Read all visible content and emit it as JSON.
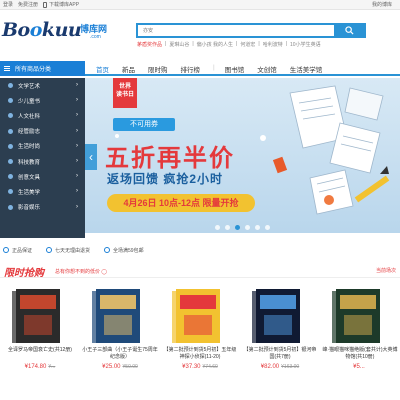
{
  "topbar": {
    "login": "登录",
    "register": "免费注册",
    "app": "下载博库APP",
    "account": "我的博库"
  },
  "logo": {
    "brand_a": "Bo",
    "brand_oo": "o",
    "brand_b": "kuu",
    "cn": "博库网",
    "com": ".com"
  },
  "search": {
    "placeholder": "亦安"
  },
  "hotwords": [
    "茅盾奖作品",
    "夏琳山谷",
    "偏小孩 我的人生",
    "何道宏",
    "哈利波特",
    "10小学生英语"
  ],
  "nav": {
    "all_categories": "所有商品分类",
    "links": [
      "首页",
      "新品",
      "限时购",
      "排行榜",
      "图书馆",
      "文创馆",
      "生活美学馆"
    ]
  },
  "sidebar": [
    "文学艺术",
    "少儿童书",
    "人文社科",
    "经管励志",
    "生活时尚",
    "科技教育",
    "创意文具",
    "生活美学",
    "影音娱乐"
  ],
  "banner": {
    "festival_line1": "世界",
    "festival_line2": "读书日",
    "tag": "不可用券",
    "headline": "五折再半价",
    "subline": "返场回馈 疯抢2小时",
    "date": "4月26日 10点-12点 限量开抢",
    "dot_count": 6,
    "active_dot": 2
  },
  "guarantees": [
    "正品保证",
    "七天无理由退货",
    "全场满59包邮"
  ],
  "flash": {
    "title": "限时抢购",
    "subtitle": "总有你想不到的低价 ◯",
    "more": "当前场次"
  },
  "products": [
    {
      "name": "全译罗马帝国衰亡史(共12册)",
      "price": "¥174.80",
      "old": "¥...",
      "colors": [
        "#2b2b2b",
        "#c2462d"
      ]
    },
    {
      "name": "小王子三部曲（小王子诞生75周年纪念版）",
      "price": "¥25.00",
      "old": "¥50.00",
      "colors": [
        "#1f4a7a",
        "#d9b76a"
      ]
    },
    {
      "name": "【第二批预计到货5月初】五年级神探小侦探(11-20)",
      "price": "¥37.30",
      "old": "¥74.60",
      "colors": [
        "#f2c230",
        "#e4393c"
      ]
    },
    {
      "name": "【第二批预计到货5月初】银河帝国(共7册)",
      "price": "¥82.00",
      "old": "¥163.00",
      "colors": [
        "#101a33",
        "#4a8fd1"
      ]
    },
    {
      "name": "峰·猫眼猫咪猫绝版(套共计)大英博物馆(共10册)",
      "price": "¥5...",
      "old": "",
      "colors": [
        "#1d3a2a",
        "#c4a24a"
      ]
    }
  ]
}
